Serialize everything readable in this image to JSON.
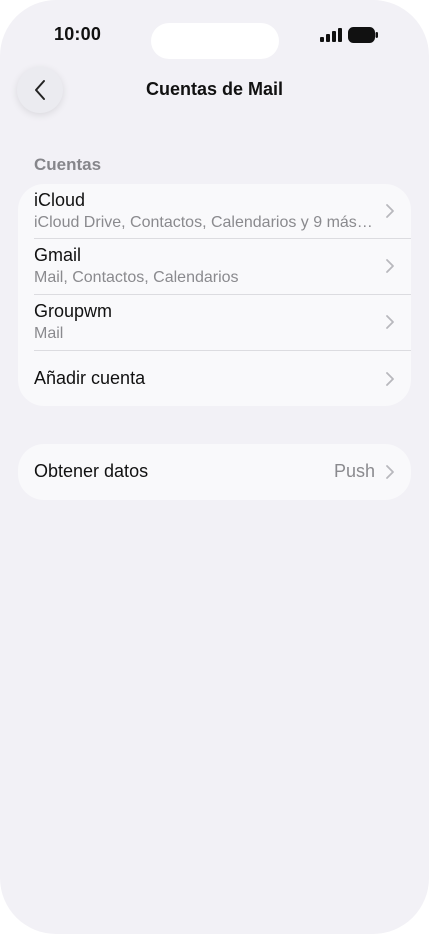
{
  "status_bar": {
    "time": "10:00",
    "signal_icon": "cellular-signal-icon",
    "battery_icon": "battery-icon"
  },
  "nav": {
    "back_icon": "chevron-left-icon",
    "title": "Cuentas de Mail"
  },
  "accounts_section": {
    "header": "Cuentas",
    "items": [
      {
        "title": "iCloud",
        "subtitle": "iCloud Drive, Contactos, Calendarios y 9 más…"
      },
      {
        "title": "Gmail",
        "subtitle": "Mail, Contactos, Calendarios"
      },
      {
        "title": "Groupwm",
        "subtitle": "Mail"
      },
      {
        "title": "Añadir cuenta"
      }
    ]
  },
  "fetch": {
    "label": "Obtener datos",
    "value": "Push"
  },
  "colors": {
    "background": "#f2f1f6",
    "card": "#f9f9fb",
    "secondary_text": "#8a8a8e"
  }
}
